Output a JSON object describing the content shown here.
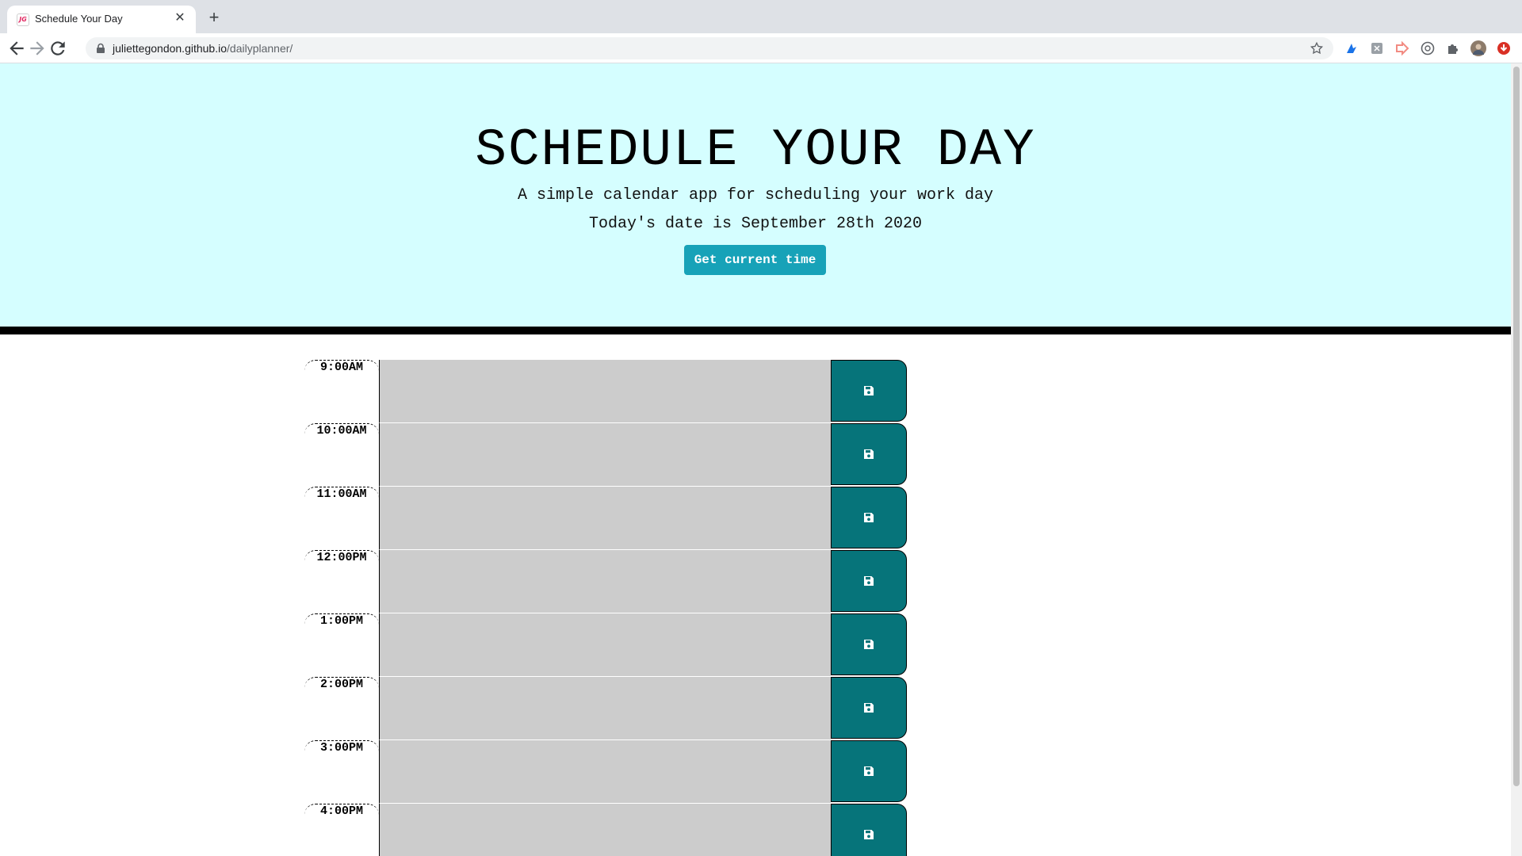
{
  "browser": {
    "tab_title": "Schedule Your Day",
    "favicon_text": "JG",
    "url_host": "juliettegondon.github.io",
    "url_path": "/dailyplanner/"
  },
  "header": {
    "title": "SCHEDULE YOUR DAY",
    "lead": "A simple calendar app for scheduling your work day",
    "date_text": "Today's date is September 28th 2020",
    "button_label": "Get current time"
  },
  "planner": {
    "hours": [
      {
        "label": "9:00AM",
        "text": ""
      },
      {
        "label": "10:00AM",
        "text": ""
      },
      {
        "label": "11:00AM",
        "text": ""
      },
      {
        "label": "12:00PM",
        "text": ""
      },
      {
        "label": "1:00PM",
        "text": ""
      },
      {
        "label": "2:00PM",
        "text": ""
      },
      {
        "label": "3:00PM",
        "text": ""
      },
      {
        "label": "4:00PM",
        "text": ""
      }
    ]
  },
  "colors": {
    "header_bg": "#d5feff",
    "button_bg": "#17a2b8",
    "save_bg": "#06747a",
    "past_bg": "#cccccc"
  },
  "icons": {
    "save": "save-floppy-icon"
  }
}
